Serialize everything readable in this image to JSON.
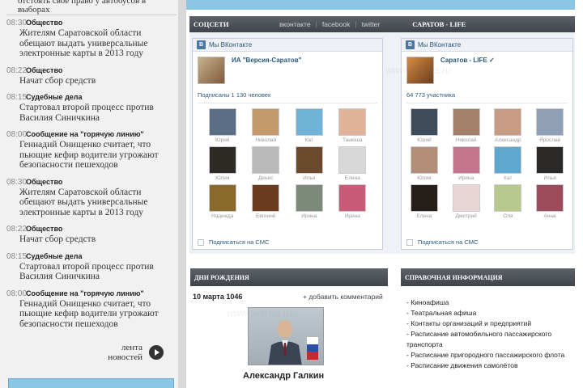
{
  "left": {
    "top_cut": "отстоять свое право у автобусов в выборах",
    "news": [
      {
        "time": "08:30",
        "category": "Общество",
        "title": "Жителям Саратовской области обещают выдать универсальные электронные карты в 2013 году"
      },
      {
        "time": "08:22",
        "category": "Общество",
        "title": "Начат сбор средств"
      },
      {
        "time": "08:15",
        "category": "Судебные дела",
        "title": "Стартовал второй процесс против Василия Синичкина"
      },
      {
        "time": "08:00",
        "category": "Сообщение на \"горячую линию\"",
        "title": "Геннадий Онищенко считает, что пьющие кефир водители угрожают безопасности пешеходов"
      },
      {
        "time": "08:30",
        "category": "Общество",
        "title": "Жителям Саратовской области обещают выдать универсальные электронные карты в 2013 году"
      },
      {
        "time": "08:22",
        "category": "Общество",
        "title": "Начат сбор средств"
      },
      {
        "time": "08:15",
        "category": "Судебные дела",
        "title": "Стартовал второй процесс против Василия Синичкина"
      },
      {
        "time": "08:00",
        "category": "Сообщение на \"горячую линию\"",
        "title": "Геннадий Онищенко считает, что пьющие кефир водители угрожают безопасности пешеходов"
      }
    ],
    "more_label": "лента новостей"
  },
  "social": {
    "title": "СОЦСЕТИ",
    "tabs": [
      "вконтакте",
      "facebook",
      "twitter"
    ],
    "right_title": "САРАТОВ - LIFE",
    "widgets": [
      {
        "head": "Мы ВКонтакте",
        "group_name": "ИА \"Версия-Саратов\"",
        "count": "Подписаны 1 130 человек",
        "sms": "Подписаться на СМС",
        "members": [
          {
            "name": "Юрий",
            "color": "#5a6f86"
          },
          {
            "name": "Николай",
            "color": "#c49a6c"
          },
          {
            "name": "Кат",
            "color": "#6fb3d6"
          },
          {
            "name": "Танюша",
            "color": "#e0b39a"
          },
          {
            "name": "Юлия",
            "color": "#2e2a26"
          },
          {
            "name": "Денис",
            "color": "#b9b9b9"
          },
          {
            "name": "Илья",
            "color": "#6b4a2e"
          },
          {
            "name": "Елена",
            "color": "#d8d8d8"
          },
          {
            "name": "Надежда",
            "color": "#8a6a2b"
          },
          {
            "name": "Евгений",
            "color": "#6b3b1d"
          },
          {
            "name": "Ирина",
            "color": "#7c8a7a"
          },
          {
            "name": "Ирина",
            "color": "#c85b78"
          }
        ]
      },
      {
        "head": "Мы ВКонтакте",
        "group_name": "Саратов - LIFE ✓",
        "count": "64 773 участника",
        "sms": "Подписаться на СМС",
        "members": [
          {
            "name": "Юрий",
            "color": "#3e4b5a"
          },
          {
            "name": "Николай",
            "color": "#a3806a"
          },
          {
            "name": "Александр",
            "color": "#c89c84"
          },
          {
            "name": "Ярослав",
            "color": "#8e9fb6"
          },
          {
            "name": "Юлия",
            "color": "#b38f79"
          },
          {
            "name": "Ирина",
            "color": "#c4758e"
          },
          {
            "name": "Кат",
            "color": "#5ea7cf"
          },
          {
            "name": "Илья",
            "color": "#2c2a28"
          },
          {
            "name": "Елена",
            "color": "#241f1b"
          },
          {
            "name": "Дмитрий",
            "color": "#e8d6d6"
          },
          {
            "name": "Оля",
            "color": "#b7c98f"
          },
          {
            "name": "Анна",
            "color": "#9d4b5a"
          }
        ]
      }
    ]
  },
  "birthdays": {
    "title": "ДНИ РОЖДЕНИЯ",
    "date": "10 марта 1046",
    "add_comment": "+ добавить комментарий",
    "person": "Александр Галкин"
  },
  "reference": {
    "title": "СПРАВОЧНАЯ ИНФОРМАЦИЯ",
    "items": [
      "- Киноафиша",
      "- Театральная афиша",
      "- Контакты организаций и предприятий",
      "- Расписание автомобильного пассажирского транспорта",
      "- Расписание пригородного пассажирского флота",
      "- Расписание движения самолётов"
    ]
  },
  "watermark": "www.sversia.ru"
}
